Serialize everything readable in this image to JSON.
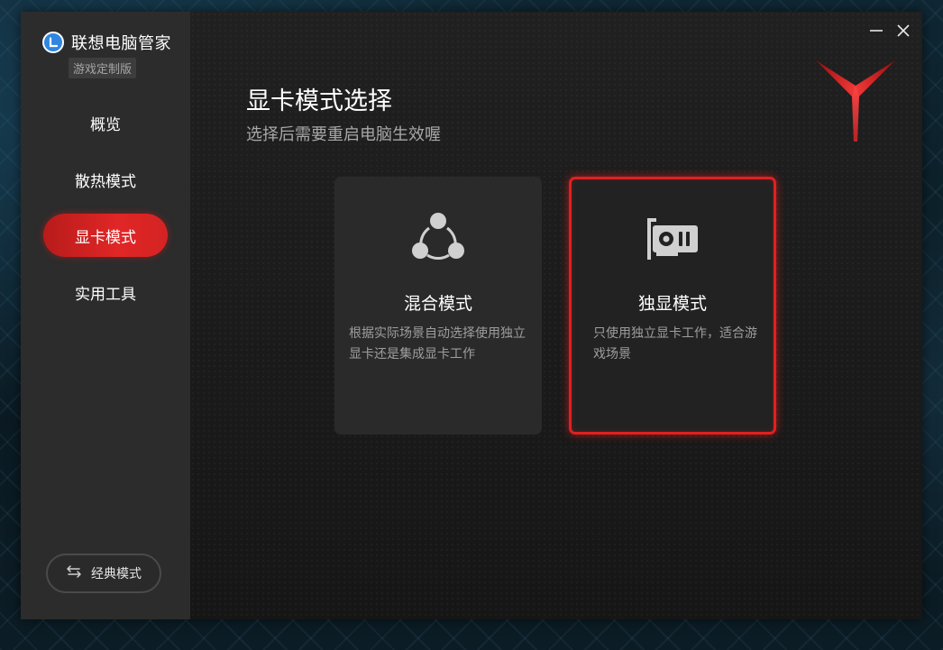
{
  "app": {
    "title": "联想电脑管家",
    "edition": "游戏定制版",
    "logo_icon": "lenovo-l-icon"
  },
  "sidebar": {
    "items": [
      {
        "label": "概览",
        "active": false
      },
      {
        "label": "散热模式",
        "active": false
      },
      {
        "label": "显卡模式",
        "active": true
      },
      {
        "label": "实用工具",
        "active": false
      }
    ],
    "classic_mode_button": {
      "label": "经典模式",
      "icon": "swap-arrows-icon"
    }
  },
  "window_controls": {
    "minimize_icon": "minimize-icon",
    "close_icon": "close-icon"
  },
  "main": {
    "title": "显卡模式选择",
    "subtitle": "选择后需要重启电脑生效喔",
    "brand_icon": "legion-y-logo",
    "cards": [
      {
        "title": "混合模式",
        "description": "根据实际场景自动选择使用独立显卡还是集成显卡工作",
        "icon": "hybrid-graph-icon",
        "selected": false
      },
      {
        "title": "独显模式",
        "description": "只使用独立显卡工作，适合游戏场景",
        "icon": "graphics-card-icon",
        "selected": true
      }
    ]
  },
  "colors": {
    "accent_red": "#e02020",
    "sidebar_bg": "#2c2c2c",
    "main_bg": "#1a1a1a",
    "card_bg": "#2a2a2a",
    "logo_blue": "#2f86e0"
  }
}
